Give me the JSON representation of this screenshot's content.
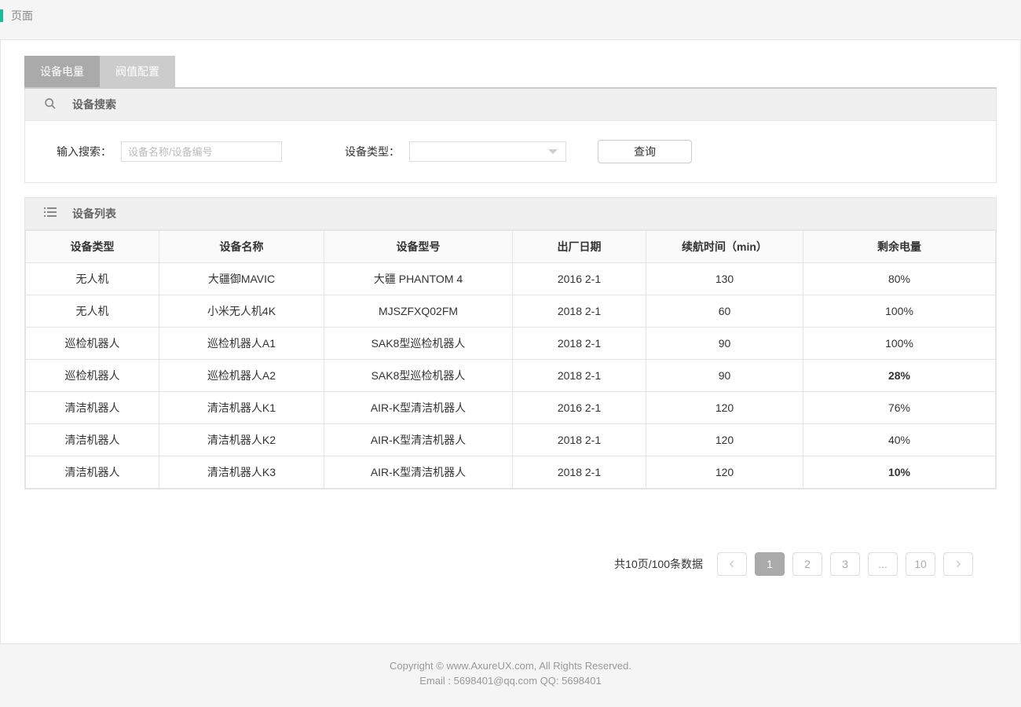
{
  "header": {
    "title": "页面"
  },
  "tabs": [
    {
      "label": "设备电量",
      "active": true
    },
    {
      "label": "阀值配置",
      "active": false
    }
  ],
  "search": {
    "section_title": "设备搜索",
    "input_label": "输入搜索：",
    "input_placeholder": "设备名称/设备编号",
    "type_label": "设备类型：",
    "query_button": "查询"
  },
  "list": {
    "section_title": "设备列表",
    "columns": [
      "设备类型",
      "设备名称",
      "设备型号",
      "出厂日期",
      "续航时间（min）",
      "剩余电量"
    ],
    "rows": [
      {
        "type": "无人机",
        "name": "大疆御MAVIC",
        "model": "大疆 PHANTOM 4",
        "date": "2016 2-1",
        "duration": "130",
        "battery": "80%",
        "low": false
      },
      {
        "type": "无人机",
        "name": "小米无人机4K",
        "model": "MJSZFXQ02FM",
        "date": "2018 2-1",
        "duration": "60",
        "battery": "100%",
        "low": false
      },
      {
        "type": "巡检机器人",
        "name": "巡检机器人A1",
        "model": "SAK8型巡检机器人",
        "date": "2018 2-1",
        "duration": "90",
        "battery": "100%",
        "low": false
      },
      {
        "type": "巡检机器人",
        "name": "巡检机器人A2",
        "model": "SAK8型巡检机器人",
        "date": "2018 2-1",
        "duration": "90",
        "battery": "28%",
        "low": true
      },
      {
        "type": "清洁机器人",
        "name": "清洁机器人K1",
        "model": "AIR-K型清洁机器人",
        "date": "2016 2-1",
        "duration": "120",
        "battery": "76%",
        "low": false
      },
      {
        "type": "清洁机器人",
        "name": "清洁机器人K2",
        "model": "AIR-K型清洁机器人",
        "date": "2018 2-1",
        "duration": "120",
        "battery": "40%",
        "low": false
      },
      {
        "type": "清洁机器人",
        "name": "清洁机器人K3",
        "model": "AIR-K型清洁机器人",
        "date": "2018 2-1",
        "duration": "120",
        "battery": "10%",
        "low": true
      }
    ]
  },
  "pagination": {
    "info": "共10页/100条数据",
    "pages": [
      "1",
      "2",
      "3",
      "...",
      "10"
    ],
    "active": "1"
  },
  "footer": {
    "line1": "Copyright © www.AxureUX.com, All Rights Reserved.",
    "line2": "Email : 5698401@qq.com  QQ: 5698401"
  }
}
